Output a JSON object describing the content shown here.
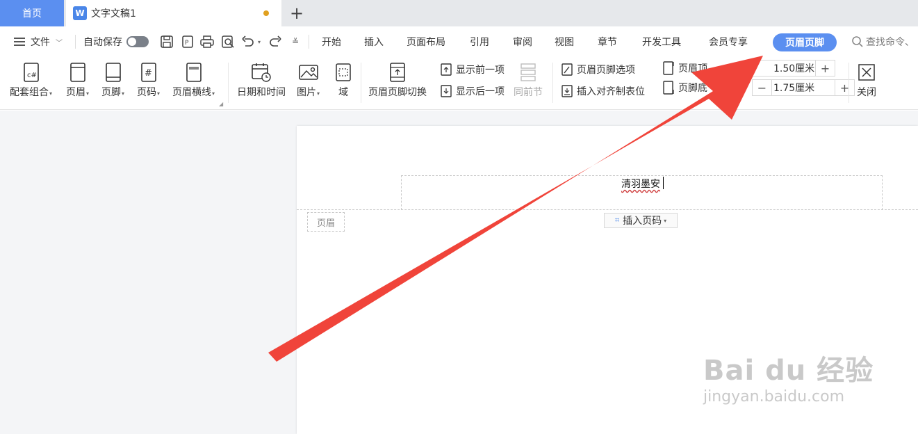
{
  "tabs": {
    "home": "首页",
    "document": "文字文稿1",
    "doc_icon": "W",
    "add": "+"
  },
  "menu": {
    "file": "文件",
    "autosave": "自动保存",
    "items": [
      "开始",
      "插入",
      "页面布局",
      "引用",
      "审阅",
      "视图",
      "章节",
      "开发工具",
      "会员专享"
    ],
    "active": "页眉页脚",
    "search": "查找命令、"
  },
  "ribbon": {
    "combo": "配套组合",
    "header": "页眉",
    "footer": "页脚",
    "page_number": "页码",
    "header_line": "页眉横线",
    "datetime": "日期和时间",
    "picture": "图片",
    "field": "域",
    "switch": "页眉页脚切换",
    "show_prev": "显示前一项",
    "show_next": "显示后一项",
    "same_as_prev": "同前节",
    "options": "页眉页脚选项",
    "insert_tab": "插入对齐制表位",
    "header_top_label": "页眉顶",
    "footer_bottom_label": "页脚底",
    "header_top_value": "1.50厘米",
    "footer_bottom_value": "1.75厘米",
    "close": "关闭"
  },
  "document": {
    "header_text": "清羽墨安",
    "header_tag": "页眉",
    "insert_page_number": "插入页码"
  },
  "watermark": {
    "brand": "Bai du 经验",
    "url": "jingyan.baidu.com"
  },
  "colors": {
    "accent": "#5b8ff0",
    "arrow": "#f0443a"
  }
}
